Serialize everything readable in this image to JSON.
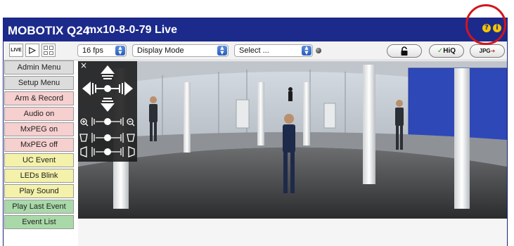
{
  "header": {
    "brand": "MOBOTIX Q24",
    "subtitle": "mx10-8-0-79 Live",
    "help_icon": "help-icon",
    "info_icon": "info-icon"
  },
  "toolbar": {
    "live_label": "LIVE",
    "fps_value": "16 fps",
    "display_mode_value": "Display Mode",
    "select_value": "Select ...",
    "hiq_label": "HiQ",
    "jpg_label": "JPG"
  },
  "sidebar": {
    "items": [
      {
        "label": "Admin Menu",
        "color": "#dcdcdc"
      },
      {
        "label": "Setup Menu",
        "color": "#dcdcdc"
      },
      {
        "label": "Arm & Record",
        "color": "#f6cfcf"
      },
      {
        "label": "Audio on",
        "color": "#f6cfcf"
      },
      {
        "label": "MxPEG on",
        "color": "#f6cfcf"
      },
      {
        "label": "MxPEG off",
        "color": "#f6cfcf"
      },
      {
        "label": "UC Event",
        "color": "#f4f1aa"
      },
      {
        "label": "LEDs Blink",
        "color": "#f4f1aa"
      },
      {
        "label": "Play Sound",
        "color": "#f4f1aa"
      },
      {
        "label": "Play Last Event",
        "color": "#a9d9a9"
      },
      {
        "label": "Event List",
        "color": "#a9d9a9"
      }
    ]
  },
  "colors": {
    "titlebar": "#1c2a8c",
    "highlight": "#d4141e"
  }
}
